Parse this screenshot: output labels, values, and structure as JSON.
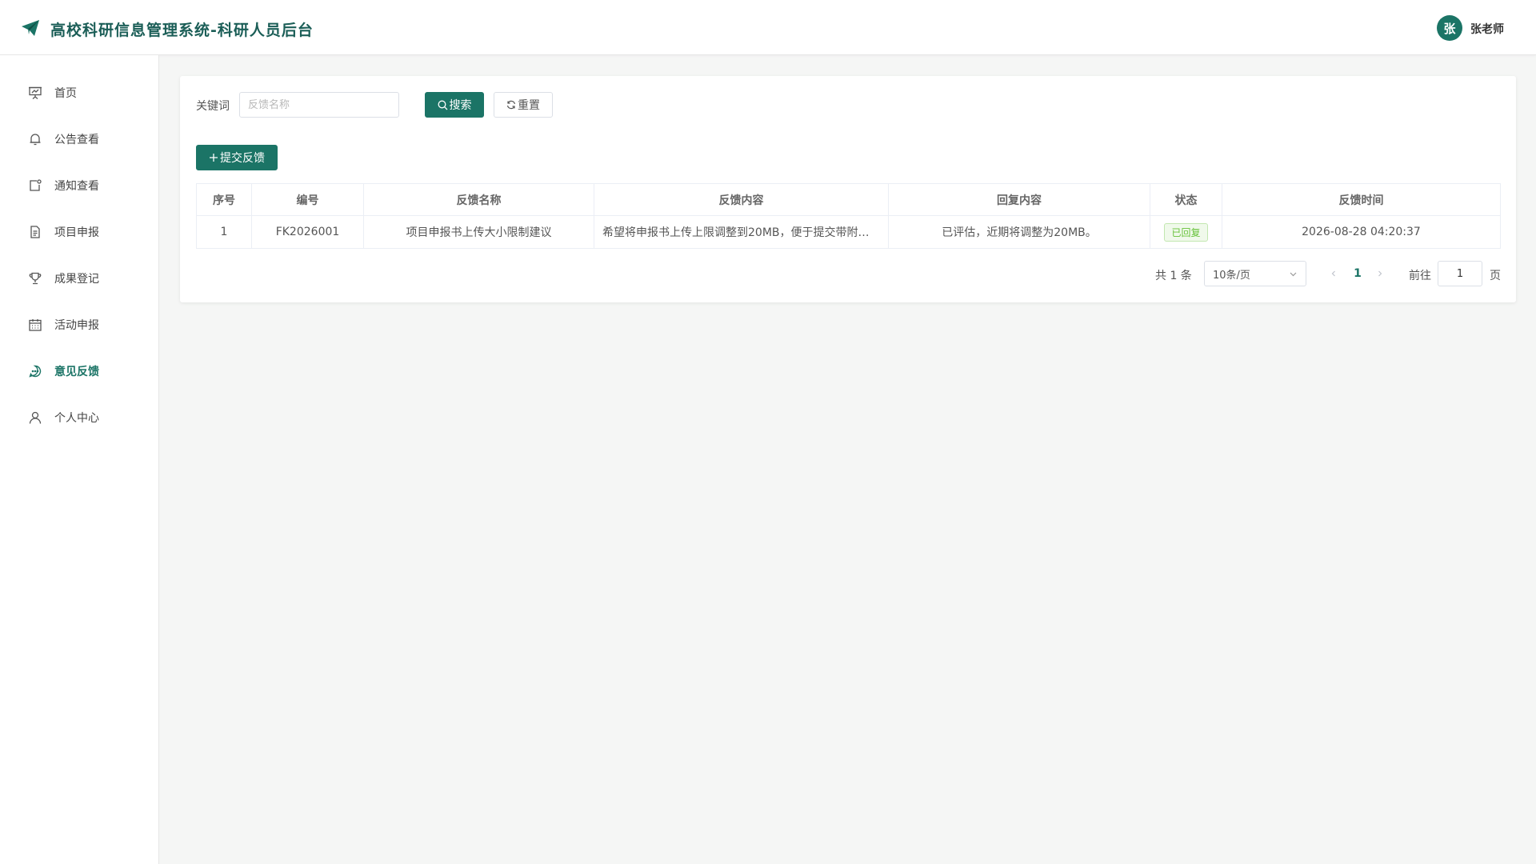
{
  "header": {
    "title": "高校科研信息管理系统-科研人员后台",
    "avatar_text": "张",
    "username": "张老师"
  },
  "sidebar": {
    "items": [
      {
        "label": "首页",
        "icon": "presentation-icon"
      },
      {
        "label": "公告查看",
        "icon": "bell-icon"
      },
      {
        "label": "通知查看",
        "icon": "message-box-icon"
      },
      {
        "label": "项目申报",
        "icon": "document-icon"
      },
      {
        "label": "成果登记",
        "icon": "trophy-icon"
      },
      {
        "label": "活动申报",
        "icon": "calendar-icon"
      },
      {
        "label": "意见反馈",
        "icon": "chat-dots-icon",
        "active": true
      },
      {
        "label": "个人中心",
        "icon": "user-icon"
      }
    ]
  },
  "search": {
    "label": "关键词",
    "value": "",
    "placeholder": "反馈名称",
    "search_button": "搜索",
    "reset_button": "重置"
  },
  "toolbar": {
    "add_button": "提交反馈"
  },
  "table": {
    "columns": [
      "序号",
      "编号",
      "反馈名称",
      "反馈内容",
      "回复内容",
      "状态",
      "反馈时间"
    ],
    "rows": [
      {
        "index": "1",
        "code": "FK2026001",
        "name": "项目申报书上传大小限制建议",
        "content": "希望将申报书上传上限调整到20MB，便于提交带附…",
        "reply": "已评估，近期将调整为20MB。",
        "status": "已回复",
        "time": "2026-08-28 04:20:37"
      }
    ]
  },
  "pagination": {
    "total": "共 1 条",
    "page_size": "10条/页",
    "current_page": "1",
    "goto_label": "前往",
    "goto_value": "1",
    "page_suffix": "页"
  },
  "colors": {
    "primary": "#1b7466",
    "success": "#67c23a"
  }
}
